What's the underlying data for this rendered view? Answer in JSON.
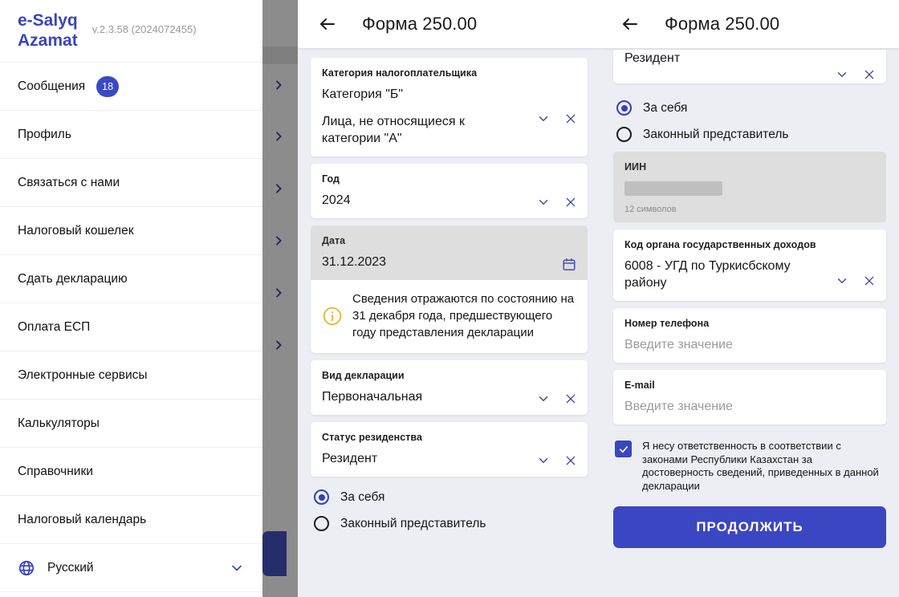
{
  "sidebar": {
    "brand_name": "e-Salyq\nAzamat",
    "version": "v.2.3.58 (2024072455)",
    "items": [
      {
        "label": "Сообщения",
        "badge": "18"
      },
      {
        "label": "Профиль",
        "badge": ""
      },
      {
        "label": "Связаться с нами",
        "badge": ""
      },
      {
        "label": "Налоговый кошелек",
        "badge": ""
      },
      {
        "label": "Сдать декларацию",
        "badge": ""
      },
      {
        "label": "Оплата ЕСП",
        "badge": ""
      },
      {
        "label": "Электронные сервисы",
        "badge": ""
      },
      {
        "label": "Калькуляторы",
        "badge": ""
      },
      {
        "label": "Справочники",
        "badge": ""
      },
      {
        "label": "Налоговый календарь",
        "badge": ""
      }
    ],
    "language": "Русский"
  },
  "middle_panel": {
    "title": "Форма 250.00",
    "back_icon": "back-arrow-icon",
    "fields": {
      "taxpayer_category": {
        "label": "Категория налогоплательщика",
        "value_line1": "Категория \"Б\"",
        "value_line2": "Лица, не относящиеся к категории \"А\""
      },
      "year": {
        "label": "Год",
        "value": "2024"
      },
      "date": {
        "label": "Дата",
        "value": "31.12.2023"
      },
      "date_info": "Сведения отражаются по состоянию на 31 декабря года, предшествующего году представления декларации",
      "declaration_type": {
        "label": "Вид декларации",
        "value": "Первоначальная"
      },
      "residency_status": {
        "label": "Статус резиденства",
        "value": "Резидент"
      }
    },
    "radios": [
      {
        "label": "За себя",
        "selected": true
      },
      {
        "label": "Законный представитель",
        "selected": false
      }
    ]
  },
  "right_panel": {
    "title": "Форма 250.00",
    "back_icon": "back-arrow-icon",
    "residency_value": "Резидент",
    "radios": [
      {
        "label": "За себя",
        "selected": true
      },
      {
        "label": "Законный представитель",
        "selected": false
      }
    ],
    "iin": {
      "label": "ИИН",
      "value": "",
      "hint": "12 символов"
    },
    "tax_authority": {
      "label": "Код органа государственных доходов",
      "value": "6008 - УГД по Туркисбскому району"
    },
    "phone": {
      "label": "Номер телефона",
      "placeholder": "Введите значение"
    },
    "email": {
      "label": "E-mail",
      "placeholder": "Введите значение"
    },
    "consent": "Я несу ответственность в соответствии с законами Республики Казахстан за достоверность сведений, приведенных в данной декларации",
    "submit_label": "ПРОДОЛЖИТЬ"
  },
  "colors": {
    "brand": "#3845bb",
    "accent": "#3b46c2",
    "badge": "#3a49c4",
    "info": "#e8b33a",
    "page_bg": "#eceef4",
    "disabled": "#dedede",
    "overlay": "#8c8c8c"
  }
}
